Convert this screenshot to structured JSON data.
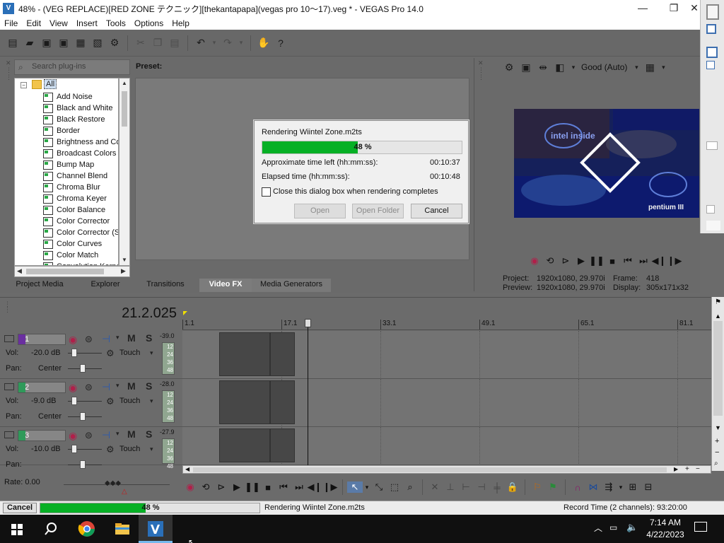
{
  "window": {
    "title": "48% - (VEG REPLACE)[RED ZONE テクニック][thekantapapa](vegas pro 10〜17).veg * - VEGAS Pro 14.0",
    "min": "—",
    "max": "❐",
    "close": "✕"
  },
  "menu": [
    "File",
    "Edit",
    "View",
    "Insert",
    "Tools",
    "Options",
    "Help"
  ],
  "plugins": {
    "search_placeholder": "Search plug-ins",
    "root": "All",
    "items": [
      "Add Noise",
      "Black and White",
      "Black Restore",
      "Border",
      "Brightness and Co",
      "Broadcast Colors",
      "Bump Map",
      "Channel Blend",
      "Chroma Blur",
      "Chroma Keyer",
      "Color Balance",
      "Color Corrector",
      "Color Corrector (S",
      "Color Curves",
      "Color Match",
      "Convolution Kerne"
    ],
    "preset_label": "Preset:"
  },
  "tabs": [
    "Project Media",
    "Explorer",
    "Transitions",
    "Video FX",
    "Media Generators"
  ],
  "active_tab": "Video FX",
  "dialog": {
    "title": "Rendering Wiintel Zone.m2ts",
    "progress": 48,
    "progress_label": "48 %",
    "time_left_label": "Approximate time left (hh:mm:ss):",
    "time_left": "00:10:37",
    "elapsed_label": "Elapsed time (hh:mm:ss):",
    "elapsed": "00:10:48",
    "checkbox_label": "Close this dialog box when rendering completes",
    "open": "Open",
    "open_folder": "Open Folder",
    "cancel": "Cancel"
  },
  "preview": {
    "quality": "Good (Auto)",
    "project_label": "Project:",
    "project_value": "1920x1080, 29.970i",
    "preview_label": "Preview:",
    "preview_value": "1920x1080, 29.970i",
    "frame_label": "Frame:",
    "frame_value": "418",
    "display_label": "Display:",
    "display_value": "305x171x32",
    "video_text_1": "intel inside",
    "video_text_2": "pentium III"
  },
  "timeline": {
    "timecode": "21.2.025",
    "ruler": [
      "1.1",
      "17.1",
      "33.1",
      "49.1",
      "65.1",
      "81.1"
    ],
    "tracks": [
      {
        "num": "1",
        "vol_label": "Vol:",
        "vol": "-20.0 dB",
        "pan_label": "Pan:",
        "pan": "Center",
        "mode": "Touch",
        "peak": "-39.0",
        "color": "#6a2fa0"
      },
      {
        "num": "2",
        "vol_label": "Vol:",
        "vol": "-9.0 dB",
        "pan_label": "Pan:",
        "pan": "Center",
        "mode": "Touch",
        "peak": "-28.0",
        "color": "#2f9a5a"
      },
      {
        "num": "3",
        "vol_label": "Vol:",
        "vol": "-10.0 dB",
        "pan_label": "Pan:",
        "pan": "",
        "mode": "Touch",
        "peak": "-27.9",
        "color": "#2f9a5a"
      }
    ],
    "meter_ticks": [
      "12",
      "24",
      "36",
      "48"
    ],
    "rate": "Rate: 0.00",
    "m_label": "M",
    "s_label": "S"
  },
  "status": {
    "cancel": "Cancel",
    "progress": 48,
    "progress_label": "48 %",
    "message": "Rendering Wiintel Zone.m2ts",
    "record_time": "Record Time (2 channels): 93:20:00"
  },
  "taskbar": {
    "time": "7:14 AM",
    "date": "4/22/2023"
  }
}
